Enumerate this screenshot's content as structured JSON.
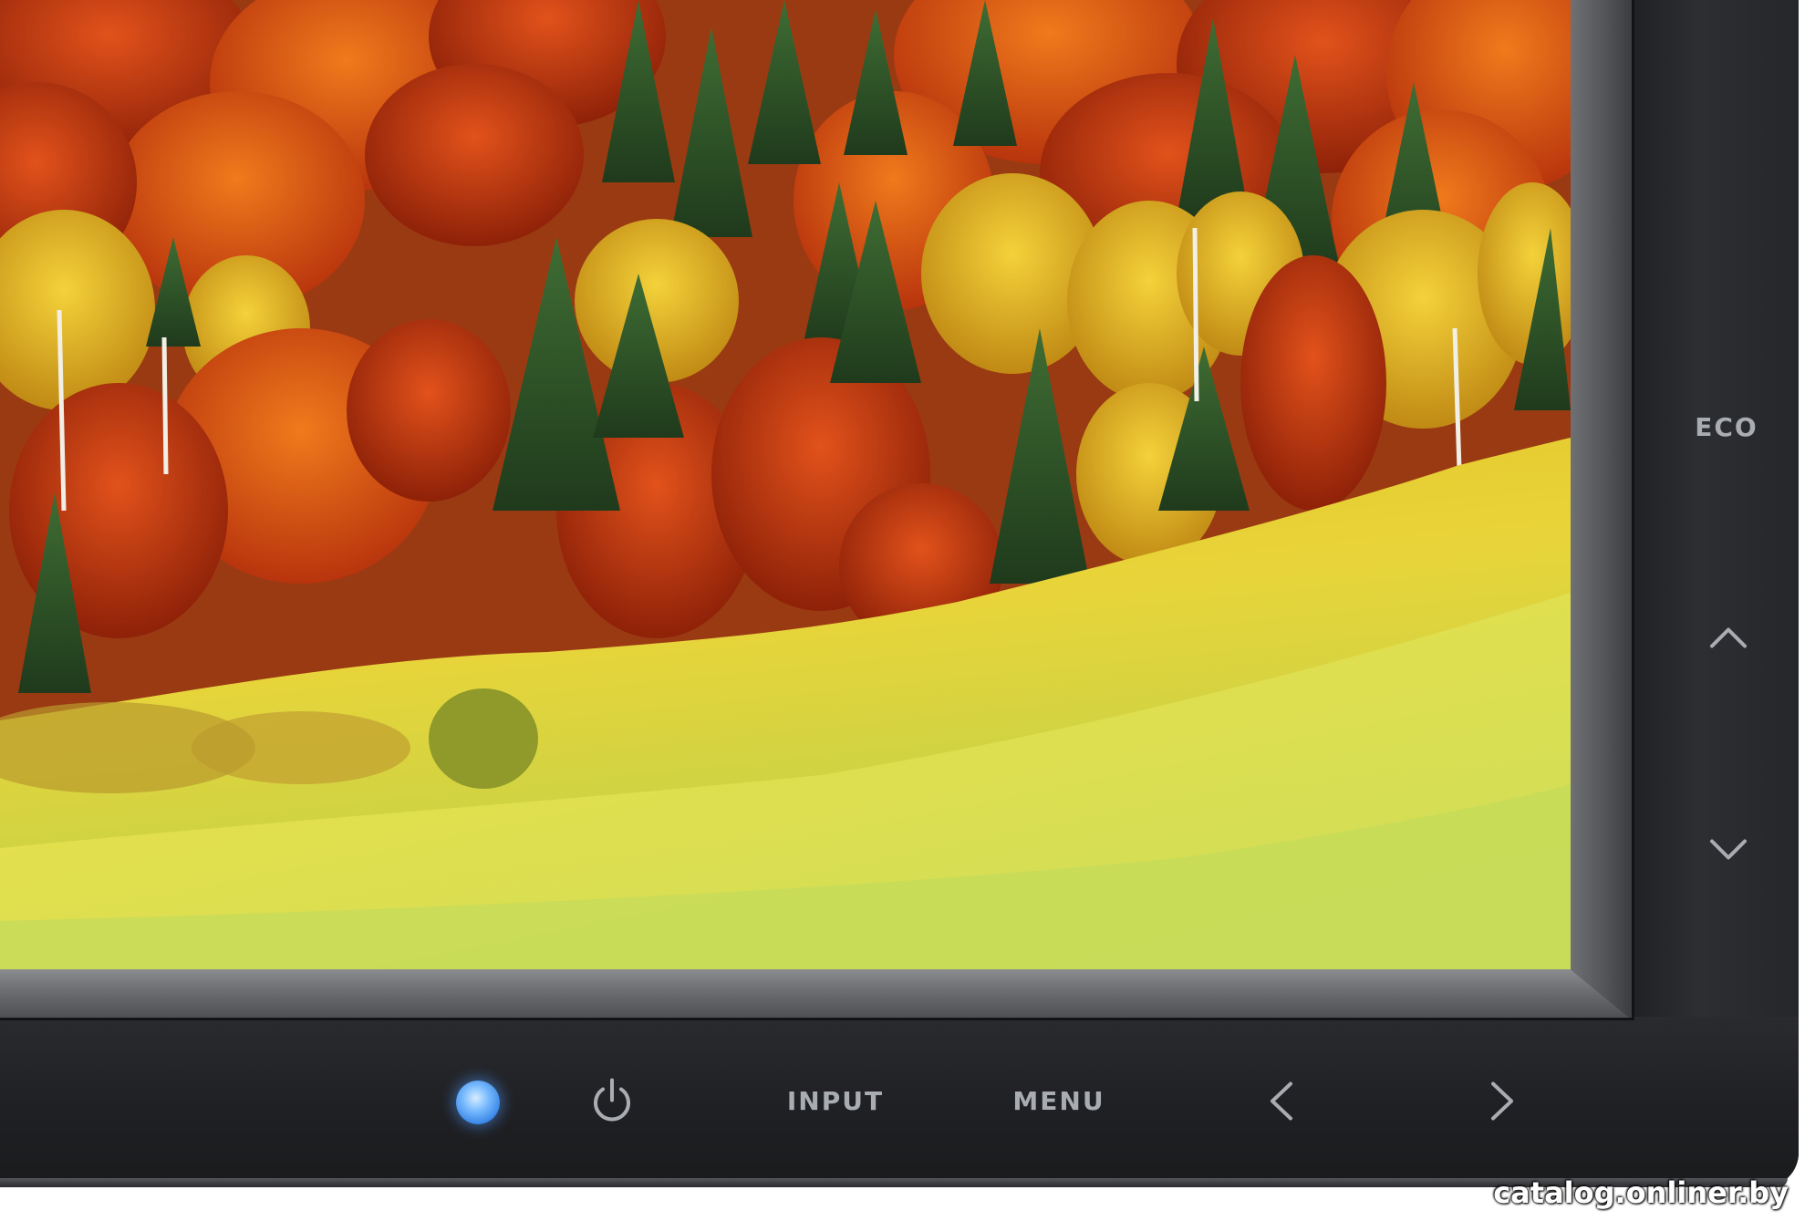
{
  "monitor": {
    "side_buttons": {
      "eco_label": "ECO",
      "up_icon": "chevron-up-icon",
      "down_icon": "chevron-down-icon"
    },
    "bottom_buttons": {
      "power_led": "power-led",
      "power_icon": "power-icon",
      "input_label": "INPUT",
      "menu_label": "MENU",
      "left_icon": "chevron-left-icon",
      "right_icon": "chevron-right-icon"
    },
    "screen_content": "autumn-forest-landscape"
  },
  "watermark": {
    "text": "catalog.onliner.by"
  },
  "colors": {
    "bezel": "#26272b",
    "bevel": "#6d6f73",
    "label": "#a9acb1",
    "led": "#4a94ff"
  }
}
